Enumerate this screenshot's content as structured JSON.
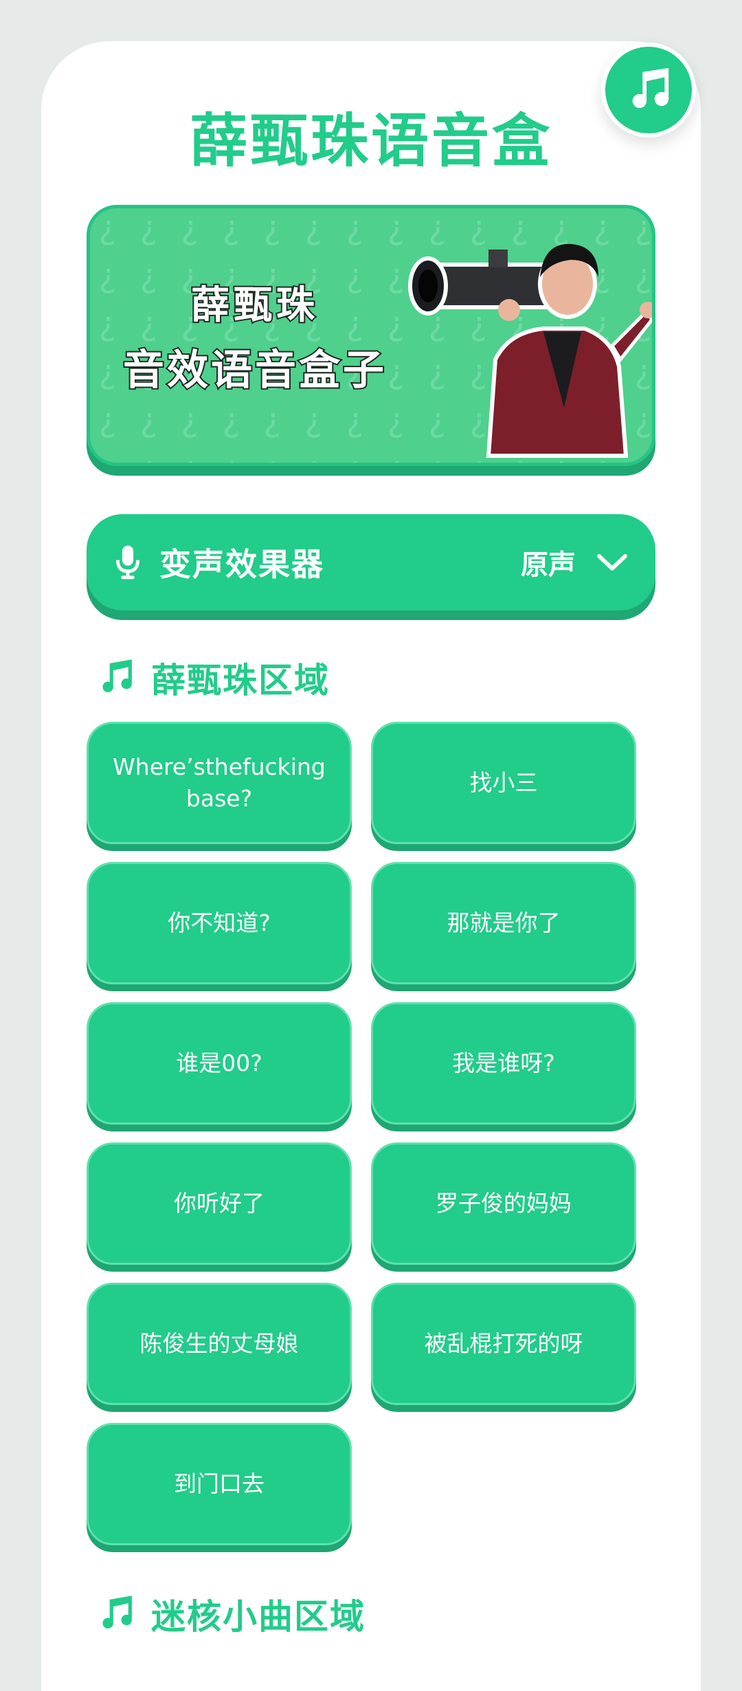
{
  "app": {
    "title": "薛甄珠语音盒",
    "music_icon": "music-note-icon",
    "accent_color": "#22cc8a",
    "shadow_color": "#1ea773",
    "background_color": "#e6ebe9"
  },
  "banner": {
    "line1": "薛甄珠",
    "line2": "音效语音盒子",
    "background_color": "#4fd08d"
  },
  "voice_changer": {
    "icon": "microphone-icon",
    "label": "变声效果器",
    "selected": "原声",
    "chevron": "chevron-down-icon"
  },
  "sections": [
    {
      "title": "薛甄珠区域",
      "icon": "music-note-icon",
      "buttons": [
        "Where’sthefucking base?",
        "找小三",
        "你不知道?",
        "那就是你了",
        "谁是00?",
        "我是谁呀?",
        "你听好了",
        "罗子俊的妈妈",
        "陈俊生的丈母娘",
        "被乱棍打死的呀",
        "到门口去"
      ]
    },
    {
      "title": "迷核小曲区域",
      "icon": "music-note-icon"
    }
  ]
}
